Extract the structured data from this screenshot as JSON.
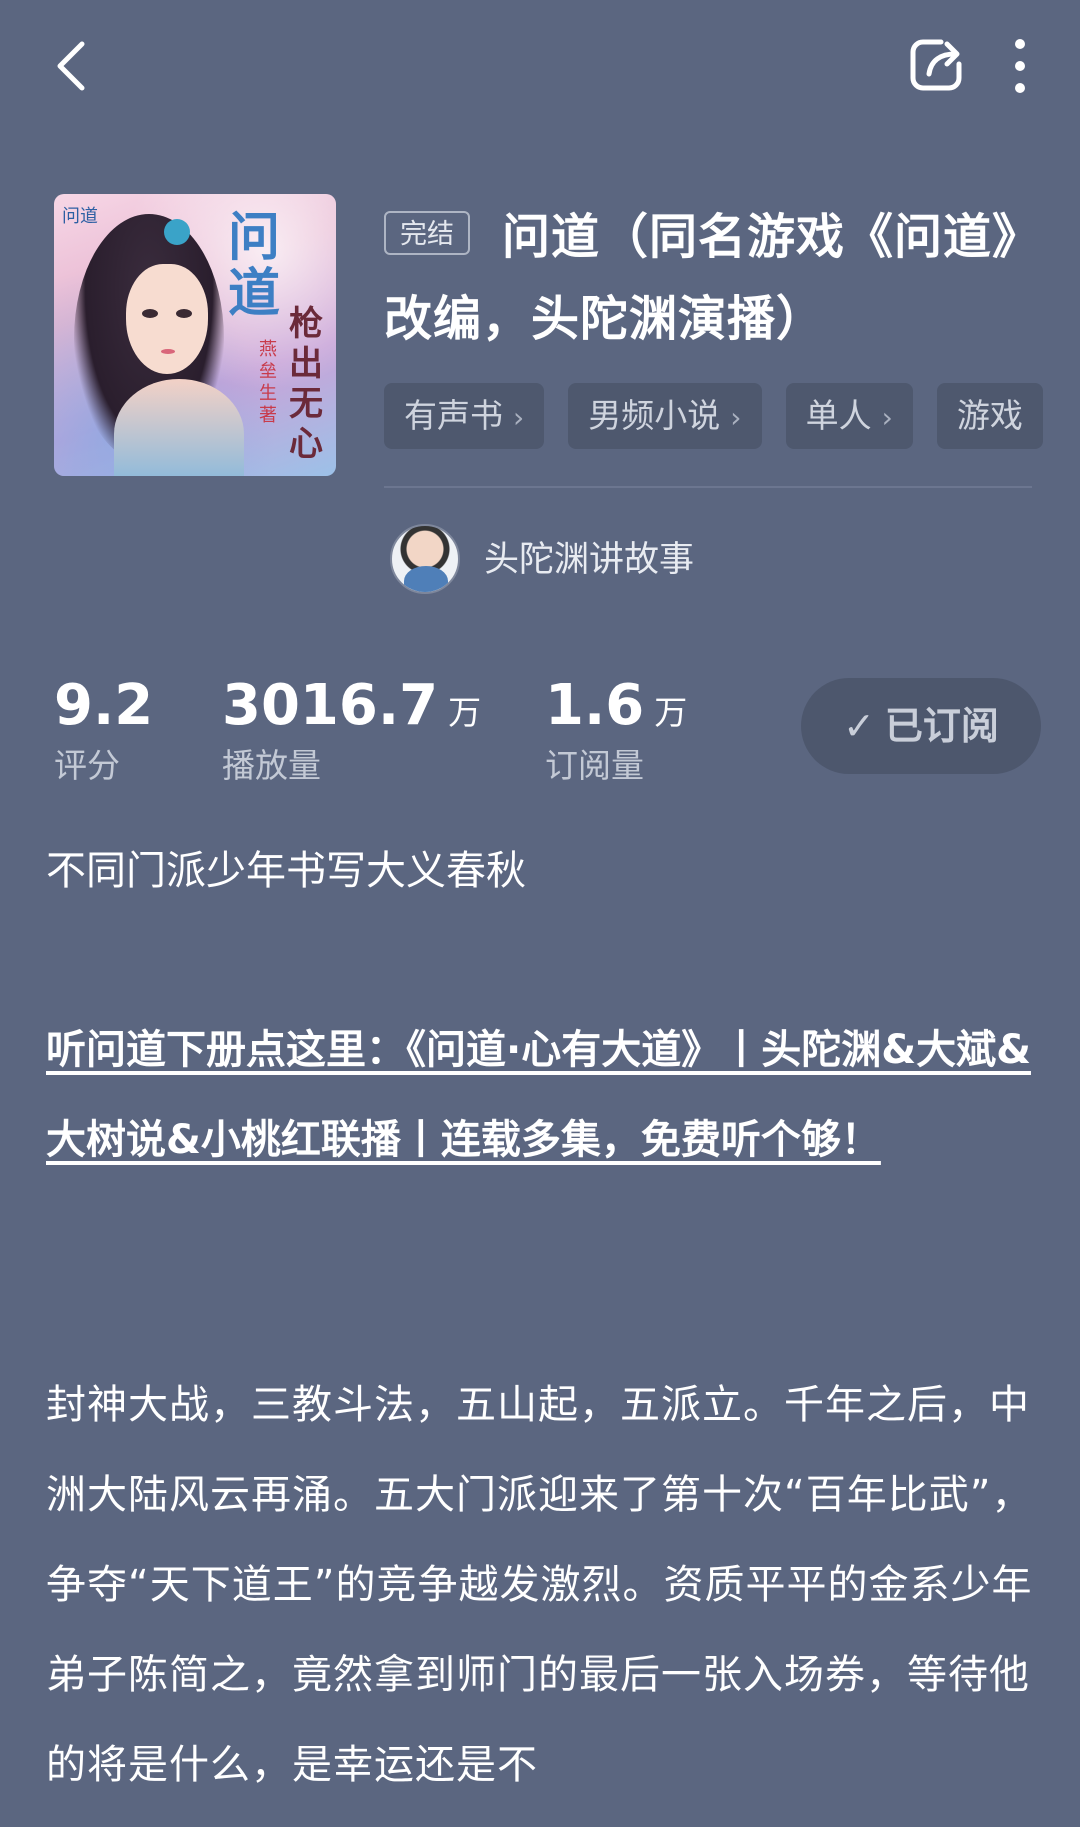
{
  "book": {
    "status": "完结",
    "title": "问道（同名游戏《问道》改编，头陀渊演播）",
    "cover": {
      "title": "问道",
      "subtitle": "枪出无心",
      "author_mark": "燕垒生 著",
      "logo": "问道"
    },
    "tags": [
      "有声书",
      "男频小说",
      "单人",
      "游戏"
    ]
  },
  "author": {
    "name": "头陀渊讲故事"
  },
  "stats": {
    "rating": {
      "value": "9.2",
      "label": "评分"
    },
    "plays": {
      "value": "3016.7",
      "unit": "万",
      "label": "播放量"
    },
    "subscribers": {
      "value": "1.6",
      "unit": "万",
      "label": "订阅量"
    }
  },
  "subscribe": {
    "label": "已订阅"
  },
  "tagline": "不同门派少年书写大义春秋",
  "promo_link": "听问道下册点这里：《问道·心有大道》丨头陀渊&大斌&大树说&小桃红联播丨连载多集，免费听个够！",
  "description": "封神大战，三教斗法，五山起，五派立。千年之后，中洲大陆风云再涌。五大门派迎来了第十次“百年比武”，争夺“天下道王”的竞争越发激烈。资质平平的金系少年弟子陈简之，竟然拿到师门的最后一张入场券，等待他的将是什么，是幸运还是不"
}
